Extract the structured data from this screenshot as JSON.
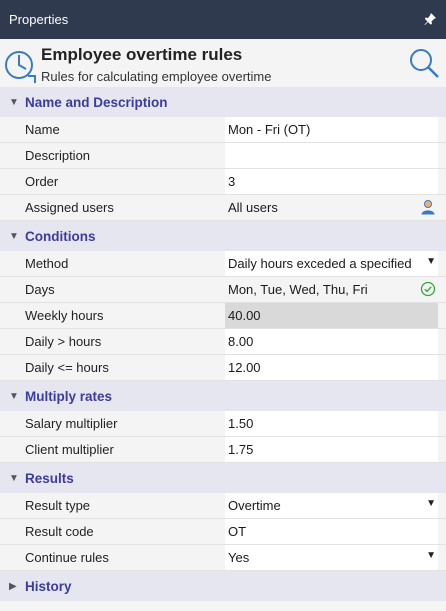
{
  "panel": {
    "title": "Properties",
    "pin_icon": "pin-icon"
  },
  "header": {
    "title": "Employee overtime rules",
    "subtitle": "Rules for calculating employee overtime",
    "icon": "clock-icon",
    "search_icon": "search-icon"
  },
  "sections": {
    "name_description": {
      "label": "Name and Description",
      "rows": {
        "name": {
          "label": "Name",
          "value": "Mon - Fri (OT)"
        },
        "description": {
          "label": "Description",
          "value": ""
        },
        "order": {
          "label": "Order",
          "value": "3"
        },
        "assigned_users": {
          "label": "Assigned users",
          "value": "All users"
        }
      }
    },
    "conditions": {
      "label": "Conditions",
      "rows": {
        "method": {
          "label": "Method",
          "value": "Daily hours exceded a specified"
        },
        "days": {
          "label": "Days",
          "value": "Mon, Tue, Wed, Thu, Fri"
        },
        "weekly_hours": {
          "label": "Weekly hours",
          "value": "40.00"
        },
        "daily_gt": {
          "label": "Daily > hours",
          "value": "8.00"
        },
        "daily_lte": {
          "label": "Daily <= hours",
          "value": "12.00"
        }
      }
    },
    "multiply_rates": {
      "label": "Multiply rates",
      "rows": {
        "salary_multiplier": {
          "label": "Salary multiplier",
          "value": "1.50"
        },
        "client_multiplier": {
          "label": "Client multiplier",
          "value": "1.75"
        }
      }
    },
    "results": {
      "label": "Results",
      "rows": {
        "result_type": {
          "label": "Result type",
          "value": "Overtime"
        },
        "result_code": {
          "label": "Result code",
          "value": "OT"
        },
        "continue_rules": {
          "label": "Continue rules",
          "value": "Yes"
        }
      }
    },
    "history": {
      "label": "History"
    }
  },
  "colors": {
    "titlebar": "#2f3a4f",
    "section_bg": "#e6e6f0",
    "section_text": "#3c3c9c",
    "icon_blue": "#3a7bbf",
    "check_green": "#3aa63a"
  }
}
